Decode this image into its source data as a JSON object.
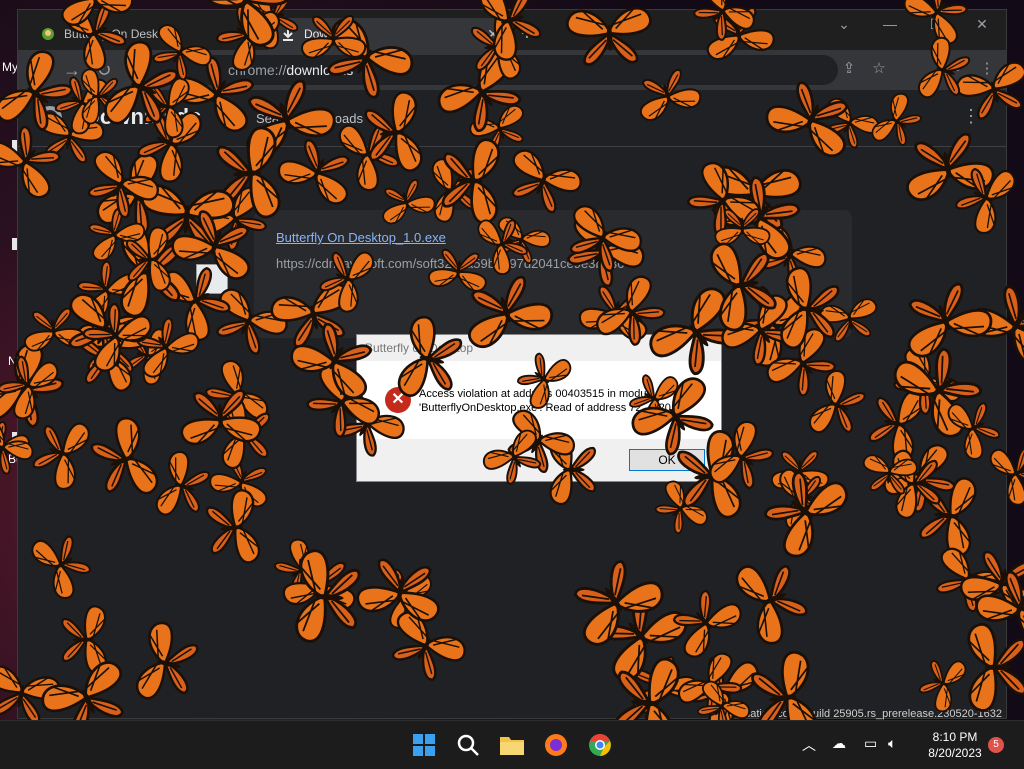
{
  "desktop": {
    "icon_labels": [
      "My",
      "N",
      "Bu"
    ]
  },
  "browser": {
    "tabs": [
      {
        "title": "Butterfly On Desktop",
        "icon": "butterfly-favicon"
      },
      {
        "title": "Downloads",
        "icon": "download-icon"
      }
    ],
    "new_tab_symbol": "+",
    "window_controls": {
      "dropdown": "⌄",
      "minimize": "—",
      "maximize": "☐",
      "close": "✕"
    },
    "address": {
      "scheme": "chrome://",
      "host": "downloads"
    }
  },
  "downloads_page": {
    "title": "Downloads",
    "search_placeholder": "Search downloads",
    "item": {
      "filename": "Butterfly On Desktop_1.0.exe",
      "url": "https://cdn.lavasoft.com/soft32/...a59b7e97d2041ce9e3b536"
    }
  },
  "error_dialog": {
    "title": "Butterfly on Desktop",
    "message_line1": "Access violation at address 00403515 in module",
    "message_line2": "'ButterflyOnDesktop.exe'. Read of address 72...C20",
    "ok_label": "OK"
  },
  "watermark": "Evaluation copy. Build 25905.rs_prerelease.230520-1632",
  "watermark_side": "ew",
  "taskbar": {
    "apps": [
      "windows-start-icon",
      "search-icon",
      "file-explorer-icon",
      "firefox-icon",
      "chrome-icon"
    ],
    "time": "8:10 PM",
    "date": "8/20/2023",
    "notification_count": "5"
  }
}
